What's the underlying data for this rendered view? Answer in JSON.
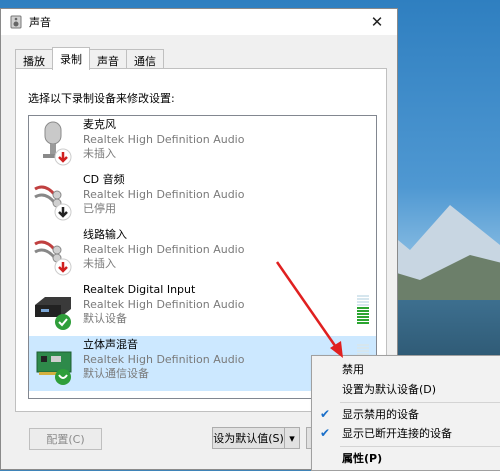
{
  "window": {
    "title": "声音"
  },
  "tabs": [
    {
      "label": "播放"
    },
    {
      "label": "录制"
    },
    {
      "label": "声音"
    },
    {
      "label": "通信"
    }
  ],
  "instruction": "选择以下录制设备来修改设置:",
  "devices": [
    {
      "name": "麦克风",
      "driver": "Realtek High Definition Audio",
      "status": "未插入",
      "icon": "microphone-icon",
      "badge": "red-down-arrow"
    },
    {
      "name": "CD 音频",
      "driver": "Realtek High Definition Audio",
      "status": "已停用",
      "icon": "cd-audio-cable-icon",
      "badge": "black-down-arrow"
    },
    {
      "name": "线路输入",
      "driver": "Realtek High Definition Audio",
      "status": "未插入",
      "icon": "line-in-cable-icon",
      "badge": "red-down-arrow"
    },
    {
      "name": "Realtek Digital Input",
      "driver": "Realtek High Definition Audio",
      "status": "默认设备",
      "icon": "digital-input-icon",
      "badge": "green-check"
    },
    {
      "name": "立体声混音",
      "driver": "Realtek High Definition Audio",
      "status": "默认通信设备",
      "icon": "sound-card-icon",
      "badge": "green-phone"
    }
  ],
  "buttons": {
    "configure": "配置(C)",
    "set_default": "设为默认值(S)"
  },
  "context_menu": [
    {
      "label": "禁用"
    },
    {
      "label": "设置为默认设备(D)"
    },
    {
      "label": "显示禁用的设备",
      "checked": true
    },
    {
      "label": "显示已断开连接的设备",
      "checked": true
    },
    {
      "label": "属性(P)",
      "bold": true
    }
  ],
  "colors": {
    "selection": "#cce8ff",
    "accent": "#1a6fc9",
    "arrow": "#e02020"
  }
}
